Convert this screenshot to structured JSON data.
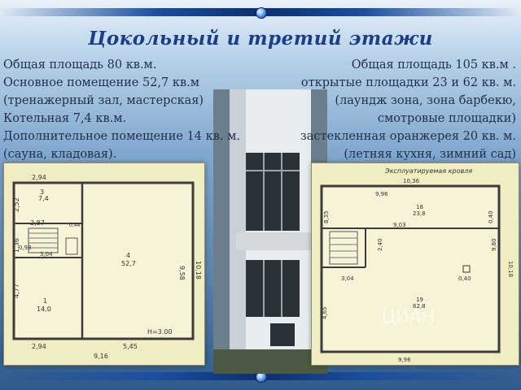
{
  "title": "Цокольный и третий этажи",
  "left_text": [
    "Общая площадь 80 кв.м.",
    "Основное помещение 52,7 кв.м",
    "(тренажерный зал, мастерская)",
    "Котельная 7,4 кв.м.",
    "Дополнительное помещение 14 кв. м.",
    "(сауна, кладовая)."
  ],
  "right_text": [
    "Общая площадь 105 кв.м .",
    "открытые площадки 23 и 62 кв. м.",
    "(лаундж зона, зона барбекю,",
    "смотровые площадки)",
    "застекленная оранжерея 20 кв. м.",
    "(летняя кухня, зимний сад)"
  ],
  "plan_left": {
    "dim_top": "2,94",
    "dim_left_top": "2,52",
    "room3_num": "3",
    "room3_area": "7,4",
    "dim_287": "2,87",
    "dim_044": "0,44",
    "dim_136": "1,36",
    "dim_098": "0,98",
    "dim_304": "3,04",
    "room4_num": "4",
    "room4_area": "52,7",
    "dim_958": "9,58",
    "dim_1018": "10,18",
    "dim_477": "4,77",
    "room1_num": "1",
    "room1_area": "14,0",
    "height": "H=3.00",
    "dim_bottom_294": "2,94",
    "dim_bottom_545": "5,45",
    "dim_916": "9,16"
  },
  "plan_right": {
    "header": "Эксплуатируемая кровля",
    "dim_1036": "10,36",
    "dim_996_top": "9,96",
    "room18_num": "18",
    "room18_area": "23,8",
    "dim_835": "8,35",
    "dim_040": "0,40",
    "dim_903": "9,03",
    "dim_240": "2,40",
    "dim_980": "9,80",
    "dim_1018": "10,18",
    "dim_304": "3,04",
    "dim_040b": "0,40",
    "room19_num": "19",
    "room19_area": "62,8",
    "dim_465": "4,65",
    "watermark": "ЦИАН",
    "dim_996_bottom": "9,96"
  }
}
